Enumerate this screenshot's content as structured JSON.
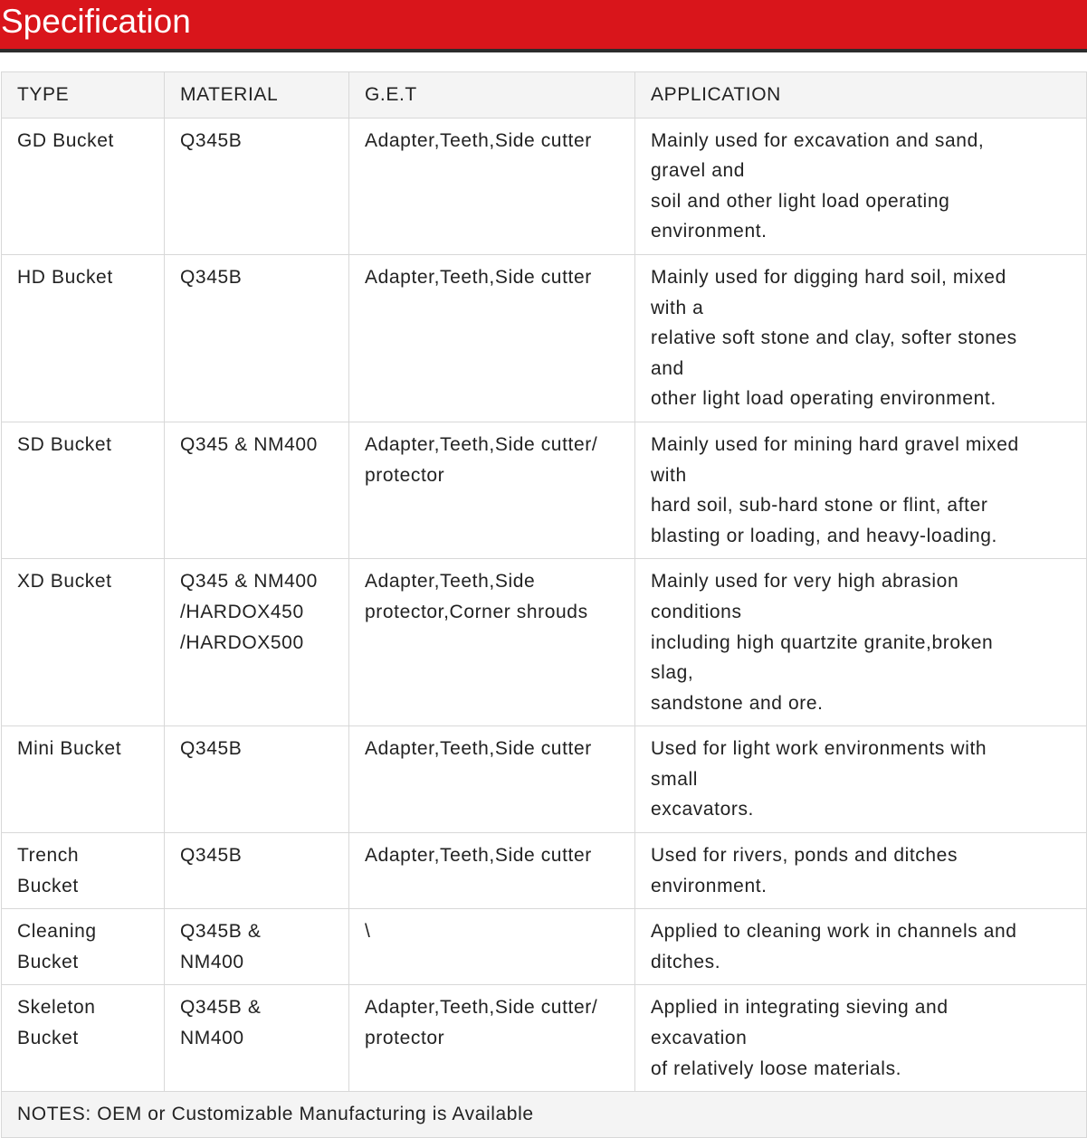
{
  "header": {
    "title": "Specification",
    "background_color": "#d9151b"
  },
  "table": {
    "columns": [
      "TYPE",
      "MATERIAL",
      "G.E.T",
      "APPLICATION"
    ],
    "rows": [
      {
        "type": [
          "GD Bucket"
        ],
        "material": [
          "Q345B"
        ],
        "get": [
          "Adapter,Teeth,Side cutter"
        ],
        "application": [
          "Mainly used for excavation and sand,",
          "gravel and",
          "soil and other light load operating",
          "environment."
        ]
      },
      {
        "type": [
          "HD Bucket"
        ],
        "material": [
          "Q345B"
        ],
        "get": [
          "Adapter,Teeth,Side cutter"
        ],
        "application": [
          "Mainly used for digging hard soil, mixed",
          "with a",
          "relative soft stone and clay, softer stones",
          "and",
          "other light load operating environment."
        ]
      },
      {
        "type": [
          "SD Bucket"
        ],
        "material": [
          "Q345 & NM400"
        ],
        "get": [
          "Adapter,Teeth,Side cutter/",
          "protector"
        ],
        "application": [
          "Mainly used for mining hard gravel mixed",
          "with",
          "hard soil, sub-hard stone or flint, after",
          "blasting or loading, and heavy-loading."
        ]
      },
      {
        "type": [
          "XD Bucket"
        ],
        "material": [
          "Q345 & NM400",
          "/HARDOX450",
          "/HARDOX500"
        ],
        "get": [
          "Adapter,Teeth,Side",
          "protector,Corner shrouds"
        ],
        "application": [
          "Mainly used for very high abrasion",
          "conditions",
          "including high quartzite granite,broken",
          "slag,",
          "sandstone and ore."
        ]
      },
      {
        "type": [
          "Mini Bucket"
        ],
        "material": [
          "Q345B"
        ],
        "get": [
          "Adapter,Teeth,Side cutter"
        ],
        "application": [
          "Used for light work environments with",
          "small",
          "excavators."
        ]
      },
      {
        "type": [
          "Trench",
          "Bucket"
        ],
        "material": [
          "Q345B"
        ],
        "get": [
          "Adapter,Teeth,Side cutter"
        ],
        "application": [
          "Used for rivers, ponds and ditches",
          "environment."
        ]
      },
      {
        "type": [
          "Cleaning",
          "Bucket"
        ],
        "material": [
          "Q345B &",
          "NM400"
        ],
        "get": [
          "\\"
        ],
        "application": [
          "Applied to cleaning work in channels and",
          "ditches."
        ]
      },
      {
        "type": [
          "Skeleton",
          "Bucket"
        ],
        "material": [
          "Q345B &",
          "NM400"
        ],
        "get": [
          "Adapter,Teeth,Side cutter/",
          "protector"
        ],
        "application": [
          "Applied in integrating sieving and",
          "excavation",
          "of relatively loose materials."
        ]
      }
    ],
    "notes": "NOTES: OEM or Customizable Manufacturing is Available"
  }
}
